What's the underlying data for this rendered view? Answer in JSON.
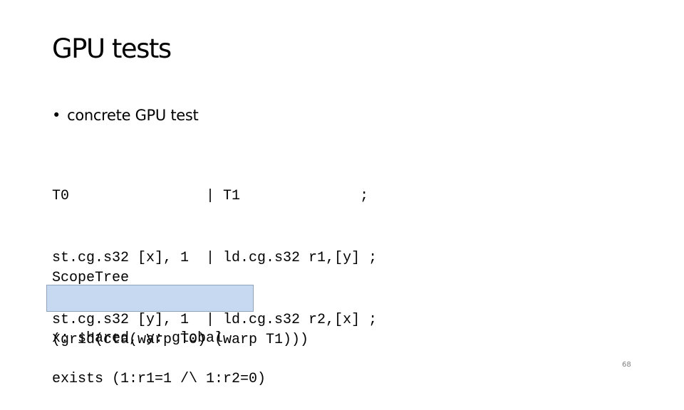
{
  "slide": {
    "title": "GPU tests",
    "bullet": {
      "marker": "•",
      "text": "concrete GPU test"
    },
    "litmus_test": {
      "lines": [
        "T0                | T1              ;",
        "st.cg.s32 [x], 1  | ld.cg.s32 r1,[y] ;",
        "st.cg.s32 [y], 1  | ld.cg.s32 r2,[x] ;"
      ]
    },
    "scope_tree": {
      "lines": [
        "ScopeTree",
        "(grid(cta(warp T0) (warp T1)))"
      ]
    },
    "memory_map": {
      "text": "x: shared, y: global",
      "highlight_color": "#c6d9f1",
      "border_color": "#8ea4bd"
    },
    "final_condition": {
      "text": "exists (1:r1=1 /\\ 1:r2=0)"
    },
    "page_number": "68"
  }
}
